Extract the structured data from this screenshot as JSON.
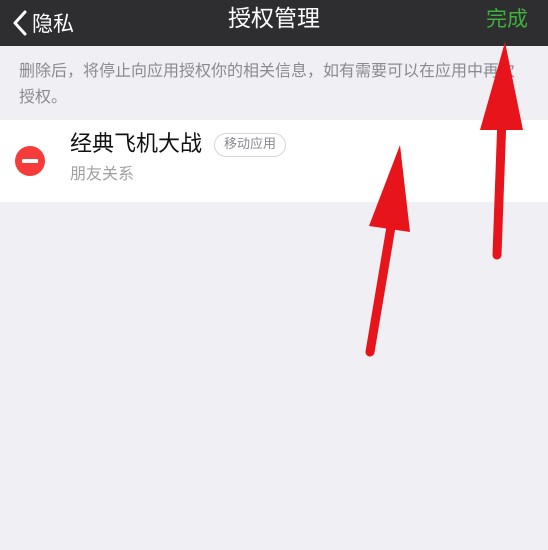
{
  "nav": {
    "back_label": "隐私",
    "title": "授权管理",
    "done_label": "完成"
  },
  "description": "删除后，将停止向应用授权你的相关信息，如有需要可以在应用中再次授权。",
  "apps": [
    {
      "name": "经典飞机大战",
      "tag": "移动应用",
      "permission": "朋友关系"
    }
  ],
  "icons": {
    "back": "chevron-left-icon",
    "delete": "minus-circle-icon"
  },
  "colors": {
    "nav_background": "#2e2e31",
    "done_text": "#3fb03b",
    "delete_button": "#f53c3a",
    "annotation_arrow": "#e8141b",
    "page_background": "#efeff4"
  }
}
